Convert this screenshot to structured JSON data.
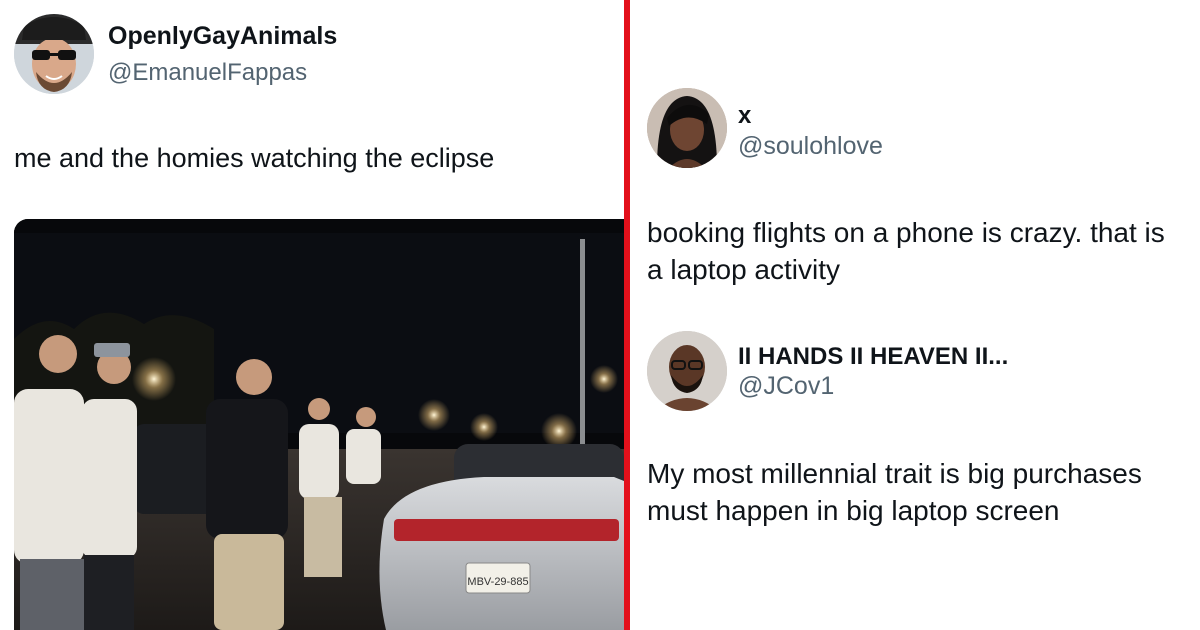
{
  "left_tweet": {
    "display_name": "OpenlyGayAnimals",
    "handle": "@EmanuelFappas",
    "text": "me and the homies watching the eclipse",
    "photo": {
      "plate_text": "MBV-29-885"
    }
  },
  "right_tweets": [
    {
      "display_name": "x",
      "handle": "@soulohlove",
      "text": "booking flights on a phone is crazy. that is a laptop activity"
    },
    {
      "display_name": "II HANDS II HEAVEN II...",
      "handle": "@JCov1",
      "text": "My most millennial trait is big purchases must happen in big laptop screen"
    }
  ],
  "colors": {
    "divider": "#e3101b",
    "text": "#0f1419",
    "handle": "#536471"
  }
}
